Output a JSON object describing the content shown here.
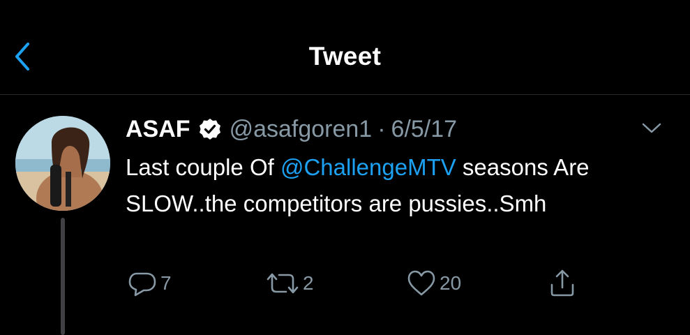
{
  "header": {
    "title": "Tweet",
    "back_icon": "chevron-left-icon",
    "accent_color": "#1da1f2"
  },
  "tweet": {
    "display_name": "ASAF",
    "verified": true,
    "handle": "@asafgoren1",
    "separator": "·",
    "date": "6/5/17",
    "text_before_mention": "Last couple Of ",
    "mention": "@ChallengeMTV",
    "text_after_mention": " seasons Are SLOW..the competitors are pussies..Smh",
    "avatar_icon": "user-avatar"
  },
  "actions": {
    "reply": {
      "icon": "reply-bubble-icon",
      "count": "7"
    },
    "retweet": {
      "icon": "retweet-icon",
      "count": "2"
    },
    "like": {
      "icon": "heart-icon",
      "count": "20"
    },
    "share": {
      "icon": "share-icon",
      "count": ""
    }
  },
  "colors": {
    "background": "#000000",
    "text": "#ffffff",
    "secondary_text": "#8899a6",
    "mention": "#1da1f2"
  }
}
